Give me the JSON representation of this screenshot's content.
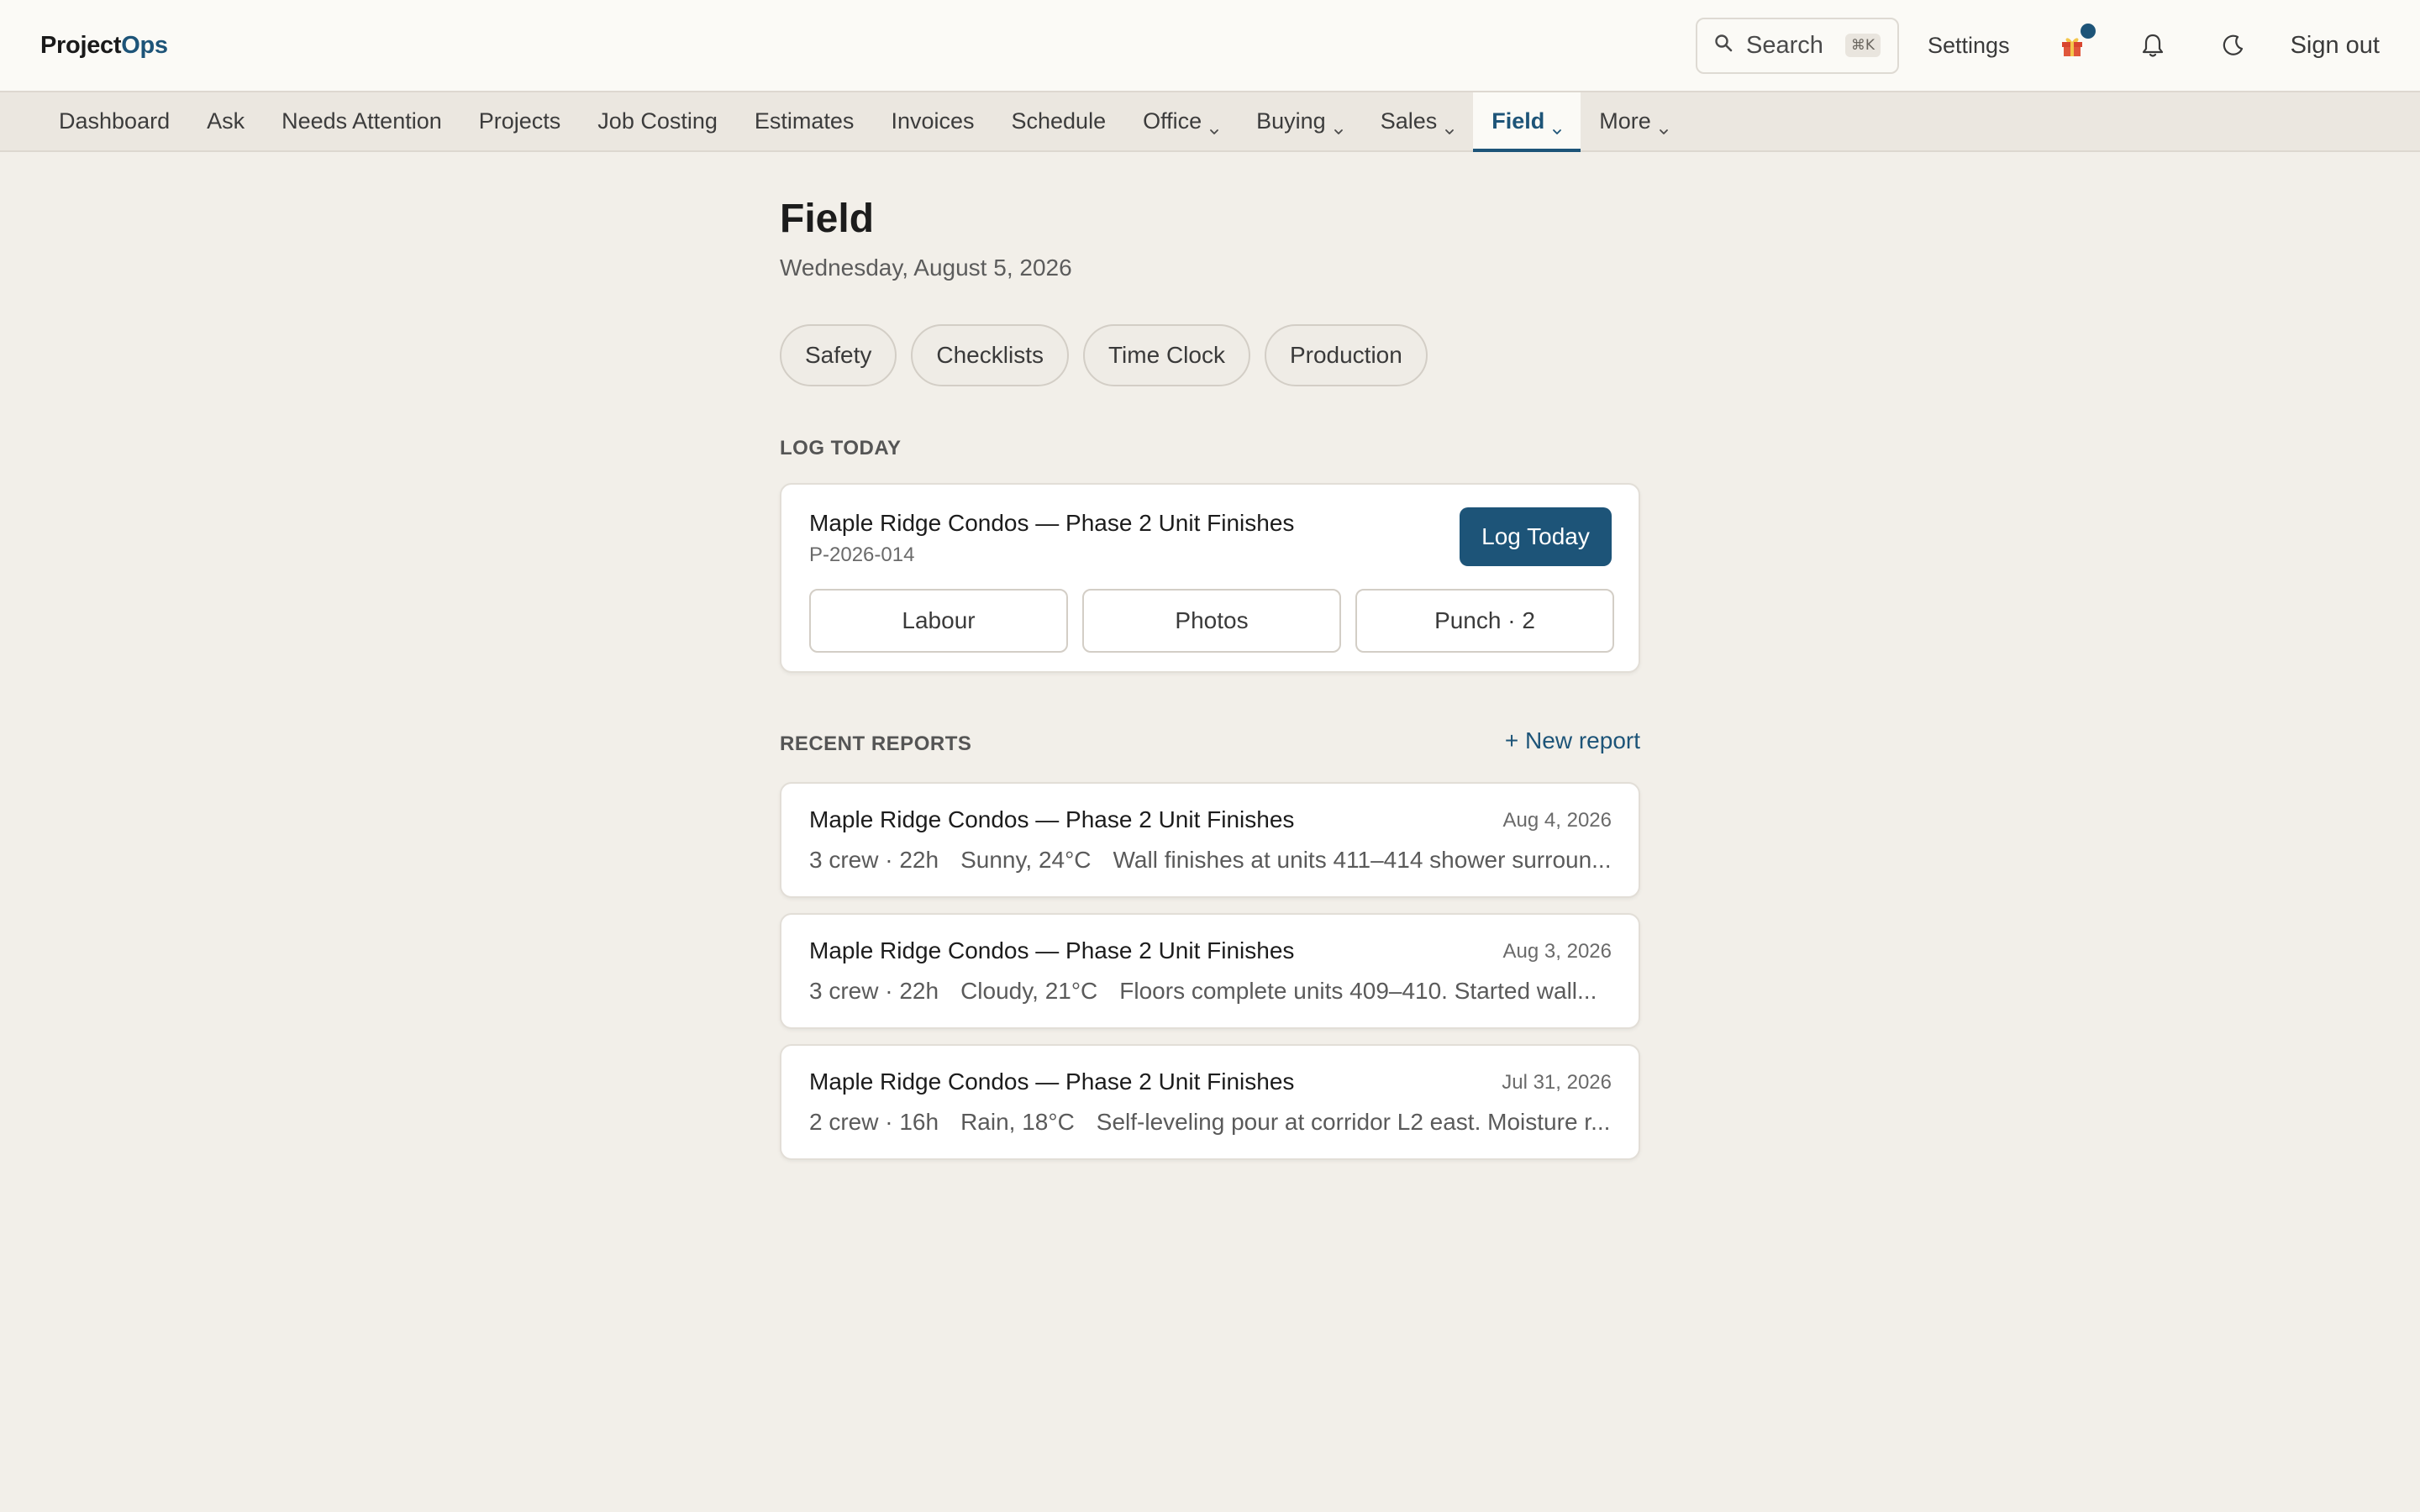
{
  "header": {
    "brand_prefix": "Project",
    "brand_accent": "Ops",
    "search_label": "Search",
    "search_shortcut": "⌘K",
    "settings_label": "Settings",
    "signout_label": "Sign out",
    "icons": [
      "search-icon",
      "gift-icon",
      "bell-icon",
      "moon-icon"
    ]
  },
  "nav": {
    "items": [
      {
        "label": "Dashboard",
        "has_menu": false
      },
      {
        "label": "Ask",
        "has_menu": false
      },
      {
        "label": "Needs Attention",
        "has_menu": false
      },
      {
        "label": "Projects",
        "has_menu": false
      },
      {
        "label": "Job Costing",
        "has_menu": false
      },
      {
        "label": "Estimates",
        "has_menu": false
      },
      {
        "label": "Invoices",
        "has_menu": false
      },
      {
        "label": "Schedule",
        "has_menu": false
      },
      {
        "label": "Office",
        "has_menu": true
      },
      {
        "label": "Buying",
        "has_menu": true
      },
      {
        "label": "Sales",
        "has_menu": true
      },
      {
        "label": "Field",
        "has_menu": true,
        "active": true
      },
      {
        "label": "More",
        "has_menu": true
      }
    ]
  },
  "page": {
    "title": "Field",
    "date": "Wednesday, August 5, 2026",
    "chips": [
      "Safety",
      "Checklists",
      "Time Clock",
      "Production"
    ]
  },
  "log_today": {
    "section_label": "LOG TODAY",
    "project_name": "Maple Ridge Condos — Phase 2 Unit Finishes",
    "project_code": "P-2026-014",
    "button_label": "Log Today",
    "actions": [
      "Labour",
      "Photos",
      "Punch · 2"
    ]
  },
  "recent_reports": {
    "section_label": "RECENT REPORTS",
    "new_report_label": "+ New report",
    "reports": [
      {
        "project": "Maple Ridge Condos — Phase 2 Unit Finishes",
        "date": "Aug 4, 2026",
        "crew": "3 crew · 22h",
        "weather": "Sunny, 24°C",
        "note": "Wall finishes at units 411–414 shower surroun..."
      },
      {
        "project": "Maple Ridge Condos — Phase 2 Unit Finishes",
        "date": "Aug 3, 2026",
        "crew": "3 crew · 22h",
        "weather": "Cloudy, 21°C",
        "note": "Floors complete units 409–410. Started wall..."
      },
      {
        "project": "Maple Ridge Condos — Phase 2 Unit Finishes",
        "date": "Jul 31, 2026",
        "crew": "2 crew · 16h",
        "weather": "Rain, 18°C",
        "note": "Self-leveling pour at corridor L2 east. Moisture r..."
      }
    ]
  },
  "colors": {
    "accent": "#1d5478",
    "background": "#f2efe9",
    "header_bg": "#fbfaf6",
    "nav_bg": "#ebe7e0"
  }
}
